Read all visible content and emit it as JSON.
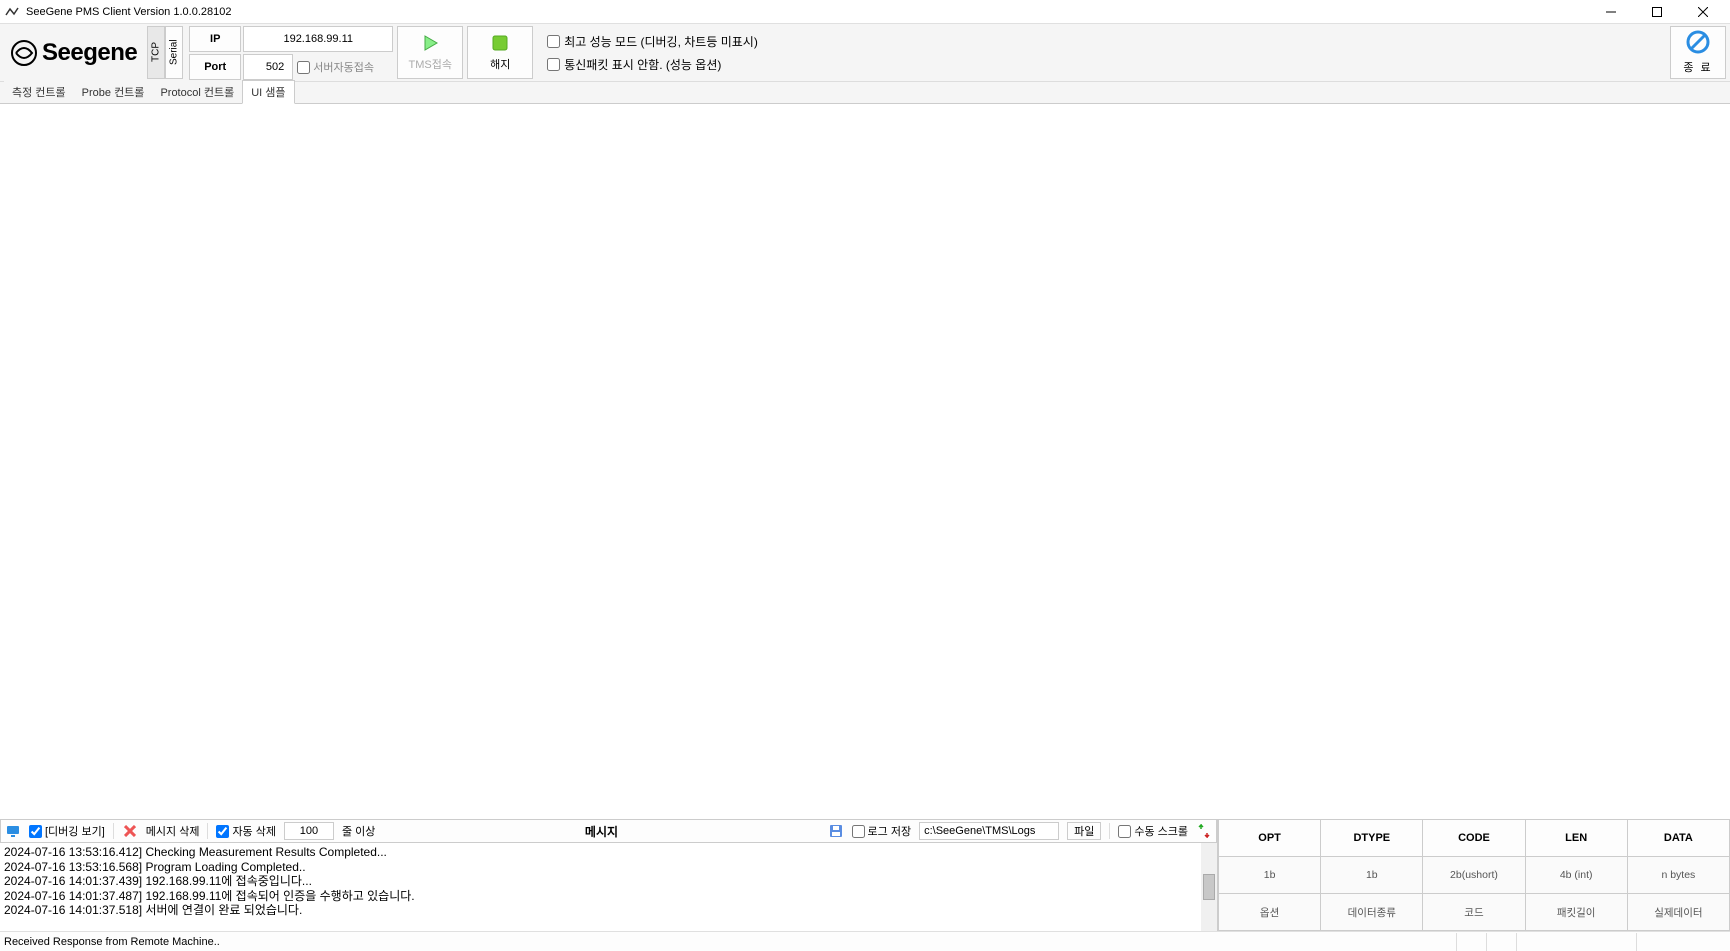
{
  "window": {
    "title": "SeeGene PMS Client Version 1.0.0.28102"
  },
  "brand": {
    "name": "Seegene"
  },
  "conn": {
    "tcp_label": "TCP",
    "serial_label": "Serial",
    "ip_label": "IP",
    "port_label": "Port",
    "ip_value": "192.168.99.11",
    "port_value": "502",
    "server_auto_connect": "서버자동접속"
  },
  "buttons": {
    "tms_connect": "TMS접속",
    "stop": "해지",
    "exit": "종 료"
  },
  "options": {
    "perf_mode": "최고 성능 모드 (디버깅, 차트등 미표시)",
    "no_packet": "통신패킷 표시 안함. (성능 옵션)"
  },
  "tabs": [
    {
      "label": "측정 컨트롤"
    },
    {
      "label": "Probe 컨트롤"
    },
    {
      "label": "Protocol 컨트롤"
    },
    {
      "label": "UI 샘플"
    }
  ],
  "msgbar": {
    "debug_view": "[디버깅 보기]",
    "msg_delete": "메시지 삭제",
    "auto_delete": "자동 삭제",
    "lines_value": "100",
    "lines_suffix": "줄 이상",
    "title": "메시지",
    "save_log": "로그 저장",
    "log_path": "c:\\SeeGene\\TMS\\Logs",
    "file_btn": "파일",
    "manual_scroll": "수동 스크롤"
  },
  "messages": [
    "2024-07-16 13:53:16.412]  Checking Measurement Results Completed...",
    "2024-07-16 13:53:16.568]  Program Loading Completed..",
    "2024-07-16 14:01:37.439]  192.168.99.11에 접속중입니다...",
    "2024-07-16 14:01:37.487]  192.168.99.11에 접속되어 인증을 수행하고 있습니다.",
    "2024-07-16 14:01:37.518]  서버에 연결이 완료 되었습니다."
  ],
  "table": {
    "headers": [
      "OPT",
      "DTYPE",
      "CODE",
      "LEN",
      "DATA"
    ],
    "row1": [
      "1b",
      "1b",
      "2b(ushort)",
      "4b (int)",
      "n bytes"
    ],
    "row2": [
      "옵션",
      "데이터종류",
      "코드",
      "패킷길이",
      "실제데이터"
    ]
  },
  "status": {
    "text": "Received Response from Remote Machine.."
  }
}
